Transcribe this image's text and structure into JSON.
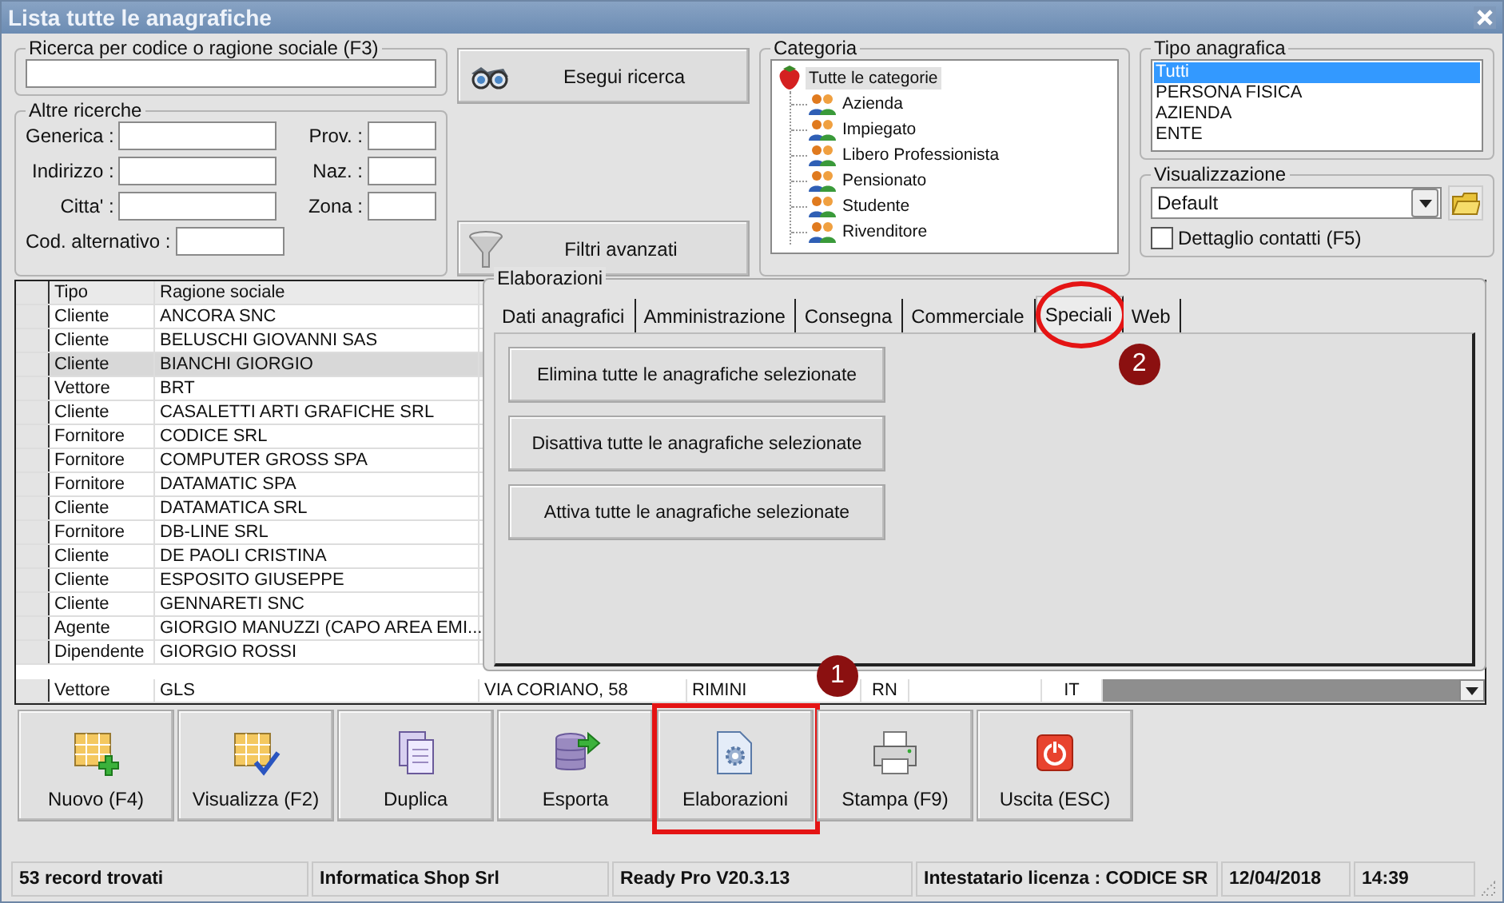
{
  "window": {
    "title": "Lista tutte le anagrafiche"
  },
  "search": {
    "legend": "Ricerca per codice o ragione sociale (F3)"
  },
  "search_button": {
    "label": "Esegui ricerca"
  },
  "filters_button": {
    "label": "Filtri avanzati"
  },
  "other_searches": {
    "legend": "Altre ricerche",
    "left_fields": [
      {
        "label": "Generica :"
      },
      {
        "label": "Indirizzo :"
      },
      {
        "label": "Citta' :"
      }
    ],
    "right_fields": [
      {
        "label": "Prov. :"
      },
      {
        "label": "Naz. :"
      },
      {
        "label": "Zona :"
      }
    ],
    "alt_code": {
      "label": "Cod. alternativo :"
    }
  },
  "category": {
    "legend": "Categoria",
    "tree": {
      "label": "Tutte le categorie",
      "selected": true,
      "children": [
        {
          "label": "Azienda",
          "selected": false
        },
        {
          "label": "Impiegato",
          "selected": false
        },
        {
          "label": "Libero Professionista",
          "selected": false
        },
        {
          "label": "Pensionato",
          "selected": false
        },
        {
          "label": "Studente",
          "selected": false
        },
        {
          "label": "Rivenditore",
          "selected": false
        }
      ]
    }
  },
  "registry_type": {
    "legend": "Tipo anagrafica",
    "items": [
      {
        "label": "Tutti",
        "selected": true
      },
      {
        "label": "PERSONA FISICA",
        "selected": false
      },
      {
        "label": "AZIENDA",
        "selected": false
      },
      {
        "label": "ENTE",
        "selected": false
      }
    ]
  },
  "view": {
    "legend": "Visualizzazione",
    "value": "Default",
    "contacts_checkbox": {
      "label": "Dettaglio contatti (F5)",
      "checked": false
    }
  },
  "table": {
    "columns": [
      "Tipo",
      "Ragione sociale"
    ],
    "rows": [
      {
        "cells": [
          "Cliente",
          "ANCORA SNC"
        ],
        "selected": false
      },
      {
        "cells": [
          "Cliente",
          "BELUSCHI GIOVANNI SAS"
        ],
        "selected": false
      },
      {
        "cells": [
          "Cliente",
          "BIANCHI GIORGIO"
        ],
        "selected": true
      },
      {
        "cells": [
          "Vettore",
          "BRT"
        ],
        "selected": false
      },
      {
        "cells": [
          "Cliente",
          "CASALETTI ARTI GRAFICHE SRL"
        ],
        "selected": false
      },
      {
        "cells": [
          "Fornitore",
          "CODICE SRL"
        ],
        "selected": false
      },
      {
        "cells": [
          "Fornitore",
          "COMPUTER GROSS SPA"
        ],
        "selected": false
      },
      {
        "cells": [
          "Fornitore",
          "DATAMATIC SPA"
        ],
        "selected": false
      },
      {
        "cells": [
          "Cliente",
          "DATAMATICA SRL"
        ],
        "selected": false
      },
      {
        "cells": [
          "Fornitore",
          "DB-LINE SRL"
        ],
        "selected": false
      },
      {
        "cells": [
          "Cliente",
          "DE PAOLI CRISTINA"
        ],
        "selected": false
      },
      {
        "cells": [
          "Cliente",
          "ESPOSITO GIUSEPPE"
        ],
        "selected": false
      },
      {
        "cells": [
          "Cliente",
          "GENNARETI SNC"
        ],
        "selected": false
      },
      {
        "cells": [
          "Agente",
          "GIORGIO MANUZZI (CAPO AREA EMI..."
        ],
        "selected": false
      },
      {
        "cells": [
          "Dipendente",
          "GIORGIO ROSSI"
        ],
        "selected": false
      },
      {
        "cells": [
          "Vettore",
          "GLS",
          "VIA CORIANO, 58",
          "RIMINI",
          "RN",
          "",
          "IT"
        ],
        "selected": false
      }
    ]
  },
  "processing": {
    "legend": "Elaborazioni",
    "tabs": [
      {
        "label": "Dati anagrafici",
        "selected": false,
        "highlighted": false
      },
      {
        "label": "Amministrazione",
        "selected": false,
        "highlighted": false
      },
      {
        "label": "Consegna",
        "selected": false,
        "highlighted": false
      },
      {
        "label": "Commerciale",
        "selected": false,
        "highlighted": false
      },
      {
        "label": "Speciali",
        "selected": true,
        "highlighted": true,
        "badge": "2"
      },
      {
        "label": "Web",
        "selected": false,
        "highlighted": false
      }
    ],
    "actions": [
      "Elimina tutte le anagrafiche selezionate",
      "Disattiva tutte le anagrafiche selezionate",
      "Attiva tutte le anagrafiche selezionate"
    ]
  },
  "toolbar": [
    {
      "label": "Nuovo (F4)",
      "highlighted": false
    },
    {
      "label": "Visualizza (F2)",
      "highlighted": false
    },
    {
      "label": "Duplica",
      "highlighted": false
    },
    {
      "label": "Esporta",
      "highlighted": false
    },
    {
      "label": "Elaborazioni",
      "highlighted": true,
      "badge": "1"
    },
    {
      "label": "Stampa (F9)",
      "highlighted": false
    },
    {
      "label": "Uscita (ESC)",
      "highlighted": false
    }
  ],
  "status_bar": [
    "53 record trovati",
    "Informatica Shop Srl",
    "Ready Pro V20.3.13",
    "Intestatario licenza : CODICE SR",
    "12/04/2018",
    "14:39"
  ]
}
